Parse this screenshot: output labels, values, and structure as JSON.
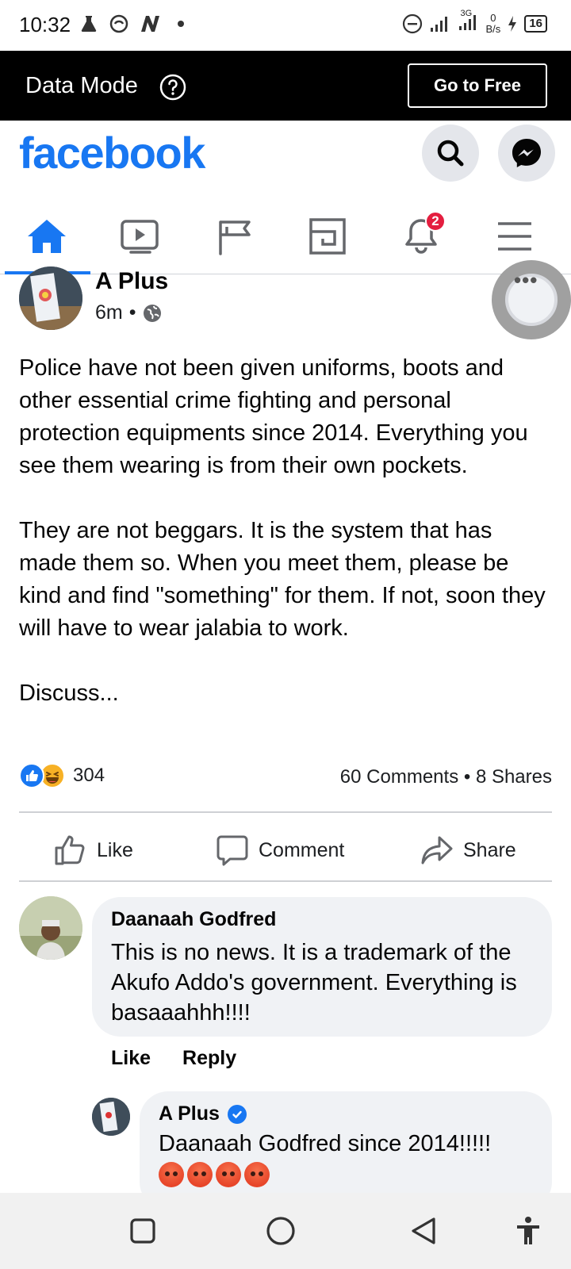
{
  "status_bar": {
    "time": "10:32",
    "network": "3G",
    "speed_value": "0",
    "speed_unit": "B/s",
    "battery": "16"
  },
  "data_mode": {
    "label": "Data Mode",
    "button": "Go to Free"
  },
  "header": {
    "logo": "facebook",
    "brand_color": "#1877f2"
  },
  "tabs": [
    {
      "name": "home",
      "icon": "home-icon",
      "active": true
    },
    {
      "name": "watch",
      "icon": "video-icon"
    },
    {
      "name": "pages",
      "icon": "flag-icon"
    },
    {
      "name": "marketplace",
      "icon": "marketplace-icon"
    },
    {
      "name": "notifications",
      "icon": "bell-icon",
      "badge": "2"
    },
    {
      "name": "menu",
      "icon": "menu-icon"
    }
  ],
  "post": {
    "author": "A Plus",
    "time": "6m",
    "separator": "•",
    "paragraphs": [
      "Police have not been given uniforms, boots and other essential crime fighting and personal protection equipments since 2014. Everything you see them wearing is from their own pockets.",
      "They are not beggars. It is the system that has made them so. When you meet them, please be kind and find \"something\" for them. If not, soon they will have to wear jalabia to work.",
      "Discuss..."
    ],
    "reaction_count": "304",
    "comments": "60 Comments",
    "shares": "8 Shares",
    "stats_separator": "•"
  },
  "actions": {
    "like": "Like",
    "comment": "Comment",
    "share": "Share"
  },
  "comment": {
    "author": "Daanaah Godfred",
    "text": "This is no news. It is a trademark of the Akufo Addo's government. Everything is basaaahhh!!!!",
    "like": "Like",
    "reply": "Reply"
  },
  "reply": {
    "author": "A Plus",
    "text": "Daanaah Godfred since 2014!!!!!"
  }
}
